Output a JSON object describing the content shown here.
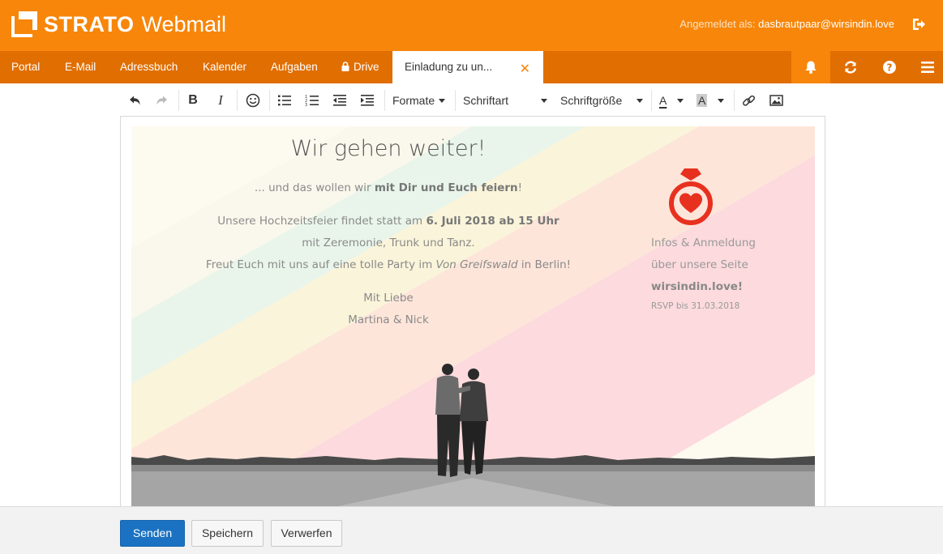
{
  "header": {
    "brand": "STRATO",
    "product": "Webmail",
    "login_label": "Angemeldet als:",
    "login_user": "dasbrautpaar@wirsindin.love"
  },
  "nav": {
    "items": [
      {
        "label": "Portal"
      },
      {
        "label": "E-Mail"
      },
      {
        "label": "Adressbuch"
      },
      {
        "label": "Kalender"
      },
      {
        "label": "Aufgaben"
      },
      {
        "label": "Drive"
      }
    ],
    "active_tab": {
      "label": "Einladung zu un..."
    },
    "icons": [
      "bell-icon",
      "refresh-icon",
      "help-icon",
      "menu-icon"
    ]
  },
  "toolbar": {
    "formats_label": "Formate",
    "font_label": "Schriftart",
    "size_label": "Schriftgröße",
    "text_color_glyph": "A",
    "bg_color_glyph": "A",
    "bold_glyph": "B",
    "italic_glyph": "I"
  },
  "invitation": {
    "title": "Wir gehen weiter!",
    "line1_pre": "... und das wollen wir ",
    "line1_bold": "mit Dir und Euch feiern",
    "line1_post": "!",
    "line2_pre": "Unsere Hochzeitsfeier findet statt am ",
    "line2_bold": "6. Juli 2018 ab 15 Uhr",
    "line3": "mit Zeremonie, Trunk und Tanz.",
    "line4_pre": "Freut Euch mit uns auf eine tolle Party im ",
    "line4_italic": "Von Greifswald",
    "line4_post": " in Berlin!",
    "signoff": "Mit Liebe",
    "names": "Martina & Nick",
    "info1": "Infos & Anmeldung",
    "info2": "über unsere Seite",
    "website": "wirsindin.love!",
    "rsvp": "RSVP bis 31.03.2018"
  },
  "actions": {
    "send": "Senden",
    "save": "Speichern",
    "discard": "Verwerfen"
  },
  "colors": {
    "brand_orange": "#f7860a",
    "nav_orange": "#e16e00",
    "primary_blue": "#1b72c2",
    "ring_red": "#e8301f"
  }
}
